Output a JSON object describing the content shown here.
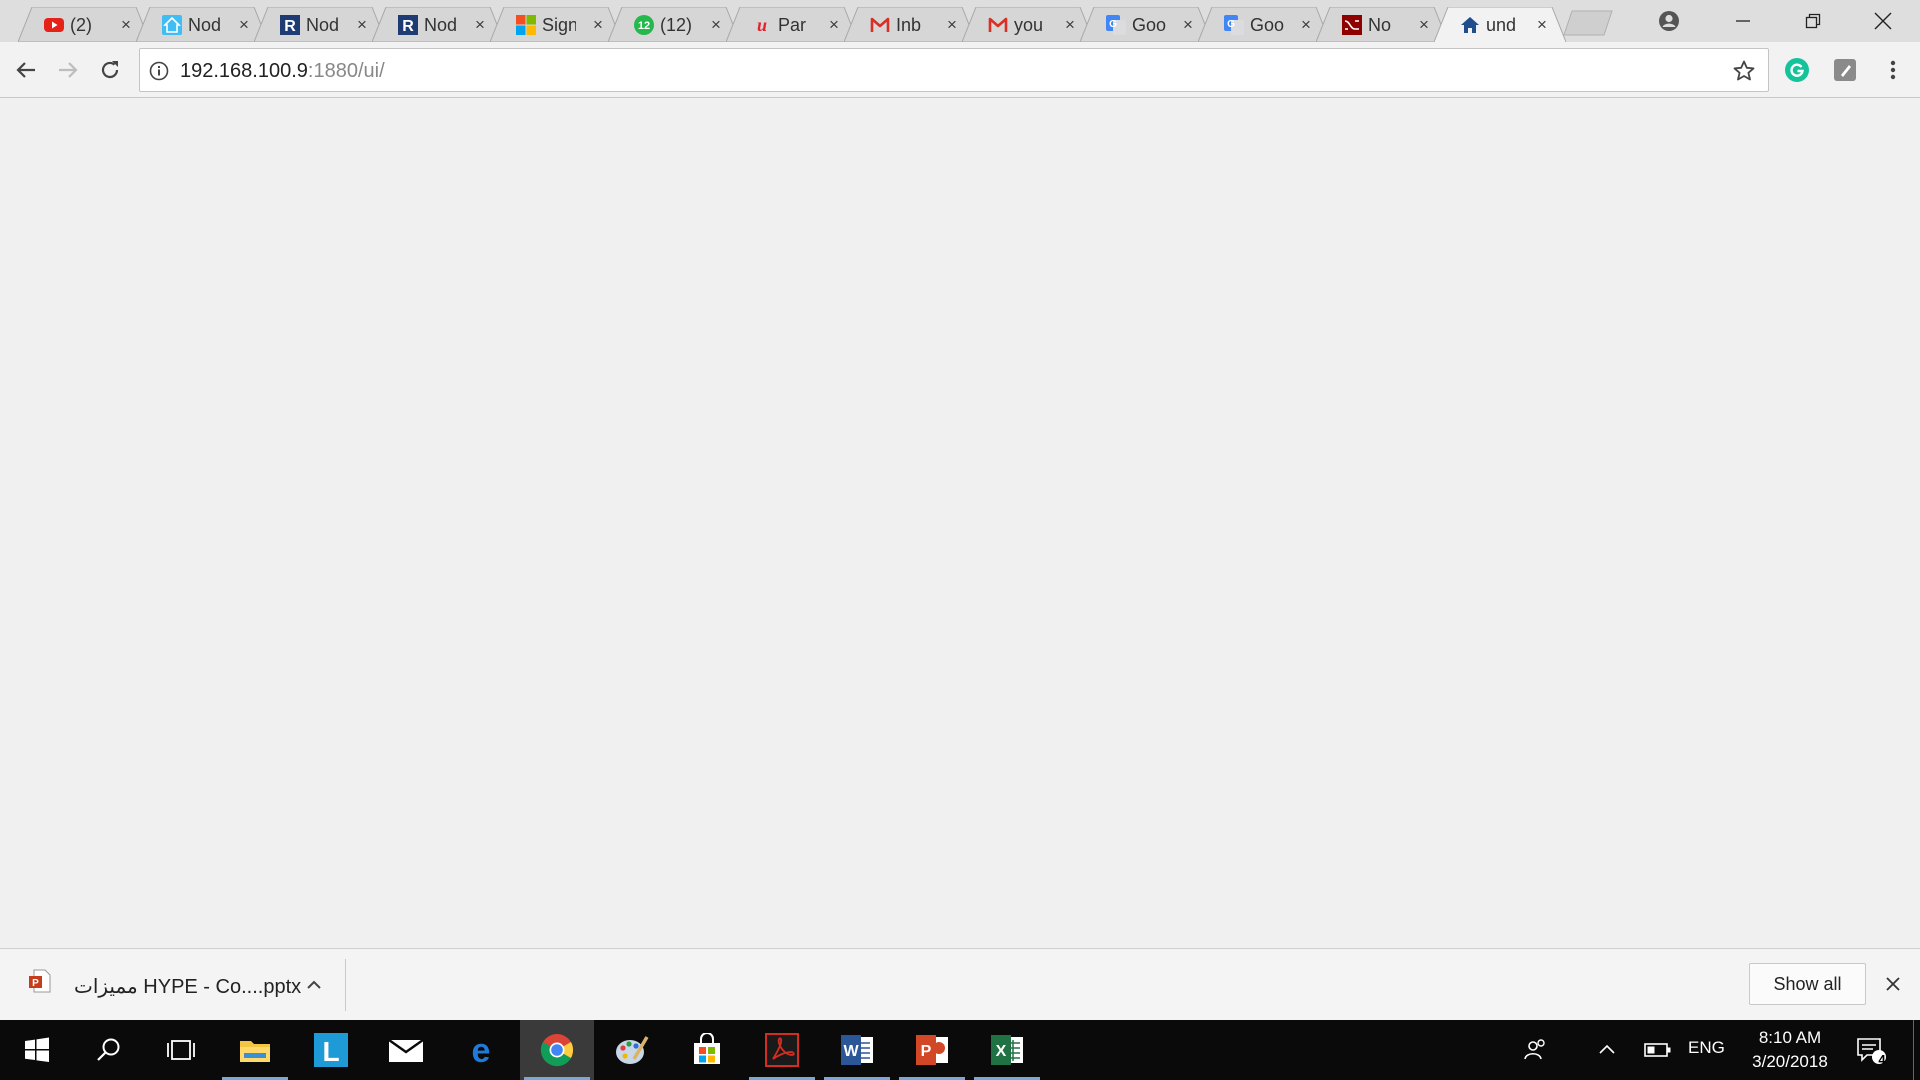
{
  "browser": {
    "tabs": [
      {
        "title": "(2) ",
        "icon": "youtube-icon"
      },
      {
        "title": "Nod",
        "icon": "home-assistant-icon"
      },
      {
        "title": "Nod",
        "icon": "r-letter-icon"
      },
      {
        "title": "Nod",
        "icon": "r-letter-icon"
      },
      {
        "title": "Sign",
        "icon": "microsoft-icon"
      },
      {
        "title": "(12)",
        "icon": "whatsapp-icon"
      },
      {
        "title": "Par",
        "icon": "u-letter-icon"
      },
      {
        "title": "Inb",
        "icon": "gmail-icon"
      },
      {
        "title": "you",
        "icon": "gmail-icon"
      },
      {
        "title": "Goo",
        "icon": "google-translate-icon"
      },
      {
        "title": "Goo",
        "icon": "google-translate-icon"
      },
      {
        "title": "No",
        "icon": "node-red-icon"
      },
      {
        "title": "und",
        "icon": "home-icon",
        "active": true
      }
    ],
    "close_glyph": "×",
    "url": {
      "host": "192.168.100.9",
      "rest": ":1880/ui/"
    }
  },
  "download_shelf": {
    "file_name": "مميزات HYPE - Co....pptx",
    "show_all_label": "Show all"
  },
  "taskbar": {
    "language": "ENG",
    "time": "8:10 AM",
    "date": "3/20/2018",
    "notification_count": "4",
    "apps": [
      "windows-start-icon",
      "search-icon",
      "task-view-icon",
      "file-explorer-icon",
      "l-app-icon",
      "mail-icon",
      "edge-icon",
      "chrome-icon",
      "paint-icon",
      "store-icon",
      "acrobat-icon",
      "word-icon",
      "powerpoint-icon",
      "excel-icon"
    ]
  },
  "colors": {
    "tabstrip": "#dedede",
    "page_bg": "#f0f0f0",
    "taskbar": "#0a0a0a",
    "running_indicator": "#7aa7d8"
  }
}
